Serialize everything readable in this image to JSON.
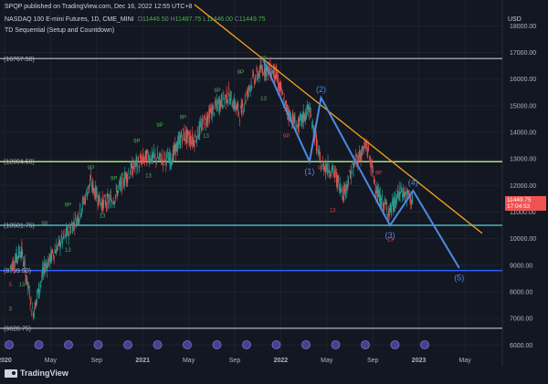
{
  "header": {
    "published": "SPQP published on TradingView.com, Dec 16, 2022 12:55 UTC+8",
    "symbol": "NASDAQ 100 E-mini Futures, 1D, CME_MINI",
    "ohlc": {
      "o_label": "O",
      "o": "11446.50",
      "h_label": "H",
      "h": "11487.75",
      "l_label": "L",
      "l": "11446.00",
      "c_label": "C",
      "c": "11449.75"
    },
    "indicator": "TD Sequential (Setup and Countdown)"
  },
  "axis_unit": "USD",
  "price_badge": {
    "price": "11449.75",
    "time": "17:04:53"
  },
  "footer": {
    "brand": "TradingView"
  },
  "colors": {
    "background": "#131722",
    "up": "#26a69a",
    "down": "#ef5350",
    "trendline_orange": "#f7a21b",
    "wave_blue": "#4b8be0",
    "level_grey": "#9598a1",
    "level_green": "#b2e07a",
    "level_cyan": "#4fb3bf",
    "level_blue": "#2962ff",
    "setup_green": "#4caf50",
    "setup_red": "#f23645"
  },
  "chart_data": {
    "type": "line",
    "title": "NASDAQ 100 E-mini Futures, 1D, CME_MINI",
    "xlabel": "",
    "ylabel": "USD",
    "ylim": [
      5700,
      18800
    ],
    "x_ticks": [
      "2020",
      "May",
      "Sep",
      "2021",
      "May",
      "Sep",
      "2022",
      "May",
      "Sep",
      "2023",
      "May"
    ],
    "y_ticks": [
      6000,
      7000,
      8000,
      9000,
      10000,
      11000,
      12000,
      13000,
      14000,
      15000,
      16000,
      17000,
      18000
    ],
    "series": [
      {
        "x": [
          "2020-01",
          "2020-02",
          "2020-03",
          "2020-04",
          "2020-05",
          "2020-06",
          "2020-07",
          "2020-08",
          "2020-09",
          "2020-10",
          "2020-11",
          "2020-12",
          "2021-01",
          "2021-02",
          "2021-03",
          "2021-04",
          "2021-05",
          "2021-06",
          "2021-07",
          "2021-08",
          "2021-09",
          "2021-10",
          "2021-11",
          "2021-12",
          "2022-01",
          "2022-02",
          "2022-03",
          "2022-04",
          "2022-05",
          "2022-06",
          "2022-07",
          "2022-08",
          "2022-09",
          "2022-10",
          "2022-11",
          "2022-12"
        ],
        "values": [
          8900,
          9600,
          7200,
          8900,
          9600,
          10200,
          10900,
          12100,
          11300,
          11500,
          12300,
          12800,
          13100,
          13000,
          13000,
          13900,
          13700,
          14500,
          15000,
          15400,
          14700,
          15900,
          16400,
          16300,
          14900,
          14200,
          14900,
          12800,
          12600,
          11700,
          12900,
          13500,
          11600,
          11000,
          11800,
          11450
        ]
      }
    ],
    "levels": [
      {
        "label": "(16767.50)",
        "value": 16767.5,
        "color": "#9598a1"
      },
      {
        "label": "(12894.50)",
        "value": 12894.5,
        "color": "#b2e07a"
      },
      {
        "label": "(10501.75)",
        "value": 10501.75,
        "color": "#4fb3bf"
      },
      {
        "label": "(8799.50)",
        "value": 8799.5,
        "color": "#2962ff"
      },
      {
        "label": "(6628.75)",
        "value": 6628.75,
        "color": "#9598a1"
      }
    ],
    "trendline": {
      "from": {
        "x": "2021-05",
        "y": 18800
      },
      "to": {
        "x": "2023-06",
        "y": 10200
      }
    },
    "waves": [
      {
        "label": "(1)",
        "x": "2022-03",
        "y": 12900
      },
      {
        "label": "(2)",
        "x": "2022-04",
        "y": 15300
      },
      {
        "label": "(3)",
        "x": "2022-10",
        "y": 10500
      },
      {
        "label": "(4)",
        "x": "2022-12",
        "y": 11800
      },
      {
        "label": "(5)",
        "x": "2023-04",
        "y": 8900
      }
    ],
    "markers": [
      {
        "text": "9P",
        "x": "2020-04",
        "y": 10500,
        "kind": "green"
      },
      {
        "text": "9P",
        "x": "2020-06",
        "y": 11200,
        "kind": "green"
      },
      {
        "text": "9P",
        "x": "2020-08",
        "y": 12600,
        "kind": "green"
      },
      {
        "text": "9P",
        "x": "2020-10",
        "y": 12200,
        "kind": "green"
      },
      {
        "text": "9P",
        "x": "2020-12",
        "y": 13600,
        "kind": "green"
      },
      {
        "text": "9P",
        "x": "2021-02",
        "y": 14200,
        "kind": "green"
      },
      {
        "text": "9P",
        "x": "2021-04",
        "y": 14500,
        "kind": "green"
      },
      {
        "text": "9P",
        "x": "2021-07",
        "y": 15500,
        "kind": "green"
      },
      {
        "text": "9P",
        "x": "2021-09",
        "y": 16200,
        "kind": "green"
      },
      {
        "text": "9P",
        "x": "2021-11",
        "y": 16700,
        "kind": "green"
      },
      {
        "text": "13",
        "x": "2020-02",
        "y": 8200,
        "kind": "green"
      },
      {
        "text": "13",
        "x": "2020-06",
        "y": 9500,
        "kind": "green"
      },
      {
        "text": "13",
        "x": "2020-09",
        "y": 10800,
        "kind": "green"
      },
      {
        "text": "13",
        "x": "2021-01",
        "y": 12300,
        "kind": "green"
      },
      {
        "text": "13",
        "x": "2021-06",
        "y": 13800,
        "kind": "green"
      },
      {
        "text": "13",
        "x": "2021-11",
        "y": 15200,
        "kind": "green"
      },
      {
        "text": "9P",
        "x": "2022-01",
        "y": 13800,
        "kind": "red"
      },
      {
        "text": "9P",
        "x": "2022-04",
        "y": 12600,
        "kind": "red"
      },
      {
        "text": "9P",
        "x": "2022-06",
        "y": 11800,
        "kind": "red"
      },
      {
        "text": "9P",
        "x": "2022-09",
        "y": 12400,
        "kind": "red"
      },
      {
        "text": "13",
        "x": "2022-01",
        "y": 14800,
        "kind": "red"
      },
      {
        "text": "13",
        "x": "2022-05",
        "y": 11000,
        "kind": "red"
      },
      {
        "text": "13",
        "x": "2022-10",
        "y": 9900,
        "kind": "red"
      },
      {
        "text": "3",
        "x": "2020-01",
        "y": 7300,
        "kind": "green"
      },
      {
        "text": "5",
        "x": "2020-01",
        "y": 8200,
        "kind": "red"
      }
    ]
  }
}
